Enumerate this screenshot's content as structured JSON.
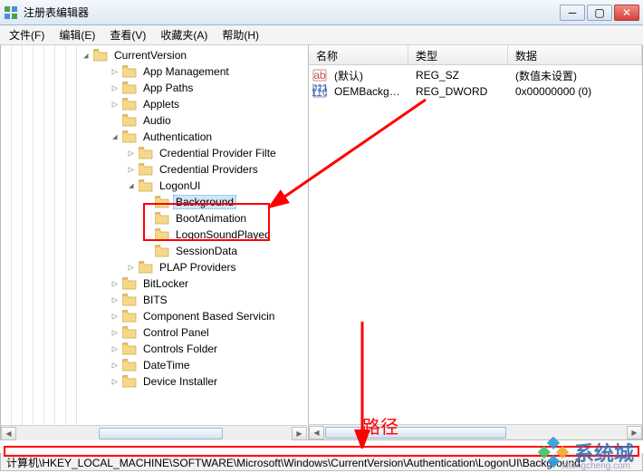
{
  "window": {
    "title": "注册表编辑器"
  },
  "menus": {
    "file": "文件(F)",
    "edit": "编辑(E)",
    "view": "查看(V)",
    "favorites": "收藏夹(A)",
    "help": "帮助(H)"
  },
  "tree": {
    "root": "CurrentVersion",
    "items": [
      {
        "label": "App Management",
        "depth": 1,
        "exp": "closed"
      },
      {
        "label": "App Paths",
        "depth": 1,
        "exp": "closed"
      },
      {
        "label": "Applets",
        "depth": 1,
        "exp": "closed"
      },
      {
        "label": "Audio",
        "depth": 1,
        "exp": "none"
      },
      {
        "label": "Authentication",
        "depth": 1,
        "exp": "open"
      },
      {
        "label": "Credential Provider Filte",
        "depth": 2,
        "exp": "closed"
      },
      {
        "label": "Credential Providers",
        "depth": 2,
        "exp": "closed"
      },
      {
        "label": "LogonUI",
        "depth": 2,
        "exp": "open"
      },
      {
        "label": "Background",
        "depth": 3,
        "exp": "none",
        "selected": true
      },
      {
        "label": "BootAnimation",
        "depth": 3,
        "exp": "none"
      },
      {
        "label": "LogonSoundPlayed",
        "depth": 3,
        "exp": "none"
      },
      {
        "label": "SessionData",
        "depth": 3,
        "exp": "none"
      },
      {
        "label": "PLAP Providers",
        "depth": 2,
        "exp": "closed"
      },
      {
        "label": "BitLocker",
        "depth": 1,
        "exp": "closed"
      },
      {
        "label": "BITS",
        "depth": 1,
        "exp": "closed"
      },
      {
        "label": "Component Based Servicin",
        "depth": 1,
        "exp": "closed"
      },
      {
        "label": "Control Panel",
        "depth": 1,
        "exp": "closed"
      },
      {
        "label": "Controls Folder",
        "depth": 1,
        "exp": "closed"
      },
      {
        "label": "DateTime",
        "depth": 1,
        "exp": "closed"
      },
      {
        "label": "Device Installer",
        "depth": 1,
        "exp": "closed"
      }
    ]
  },
  "list": {
    "cols": {
      "name": "名称",
      "type": "类型",
      "data": "数据"
    },
    "rows": [
      {
        "icon": "string",
        "name": "(默认)",
        "type": "REG_SZ",
        "data": "(数值未设置)"
      },
      {
        "icon": "dword",
        "name": "OEMBackgrou...",
        "type": "REG_DWORD",
        "data": "0x00000000 (0)"
      }
    ]
  },
  "status": {
    "path": "计算机\\HKEY_LOCAL_MACHINE\\SOFTWARE\\Microsoft\\Windows\\CurrentVersion\\Authentication\\LogonUI\\Background"
  },
  "annotation": {
    "path_label": "路径"
  },
  "watermark": {
    "brand": "系统城",
    "url": "xitongcheng.com"
  }
}
